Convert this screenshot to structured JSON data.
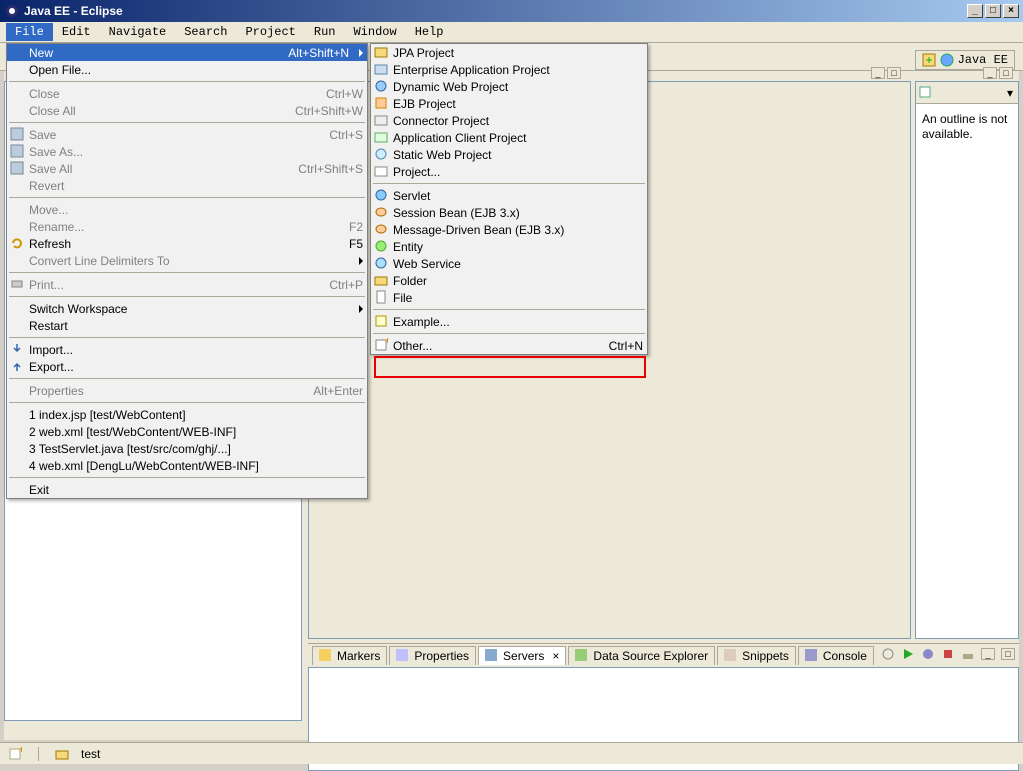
{
  "window": {
    "title": "Java EE - Eclipse"
  },
  "menubar": {
    "items": [
      "File",
      "Edit",
      "Navigate",
      "Search",
      "Project",
      "Run",
      "Window",
      "Help"
    ],
    "active_index": 0
  },
  "perspective": {
    "label": "Java EE"
  },
  "file_menu": {
    "new": {
      "label": "New",
      "accel": "Alt+Shift+N"
    },
    "open_file": {
      "label": "Open File..."
    },
    "close": {
      "label": "Close",
      "accel": "Ctrl+W"
    },
    "close_all": {
      "label": "Close All",
      "accel": "Ctrl+Shift+W"
    },
    "save": {
      "label": "Save",
      "accel": "Ctrl+S"
    },
    "save_as": {
      "label": "Save As..."
    },
    "save_all": {
      "label": "Save All",
      "accel": "Ctrl+Shift+S"
    },
    "revert": {
      "label": "Revert"
    },
    "move": {
      "label": "Move..."
    },
    "rename": {
      "label": "Rename...",
      "accel": "F2"
    },
    "refresh": {
      "label": "Refresh",
      "accel": "F5"
    },
    "convert_delim": {
      "label": "Convert Line Delimiters To"
    },
    "print": {
      "label": "Print...",
      "accel": "Ctrl+P"
    },
    "switch_ws": {
      "label": "Switch Workspace"
    },
    "restart": {
      "label": "Restart"
    },
    "import": {
      "label": "Import..."
    },
    "export": {
      "label": "Export..."
    },
    "properties": {
      "label": "Properties",
      "accel": "Alt+Enter"
    },
    "recent": [
      "1 index.jsp  [test/WebContent]",
      "2 web.xml  [test/WebContent/WEB-INF]",
      "3 TestServlet.java  [test/src/com/ghj/...]",
      "4 web.xml  [DengLu/WebContent/WEB-INF]"
    ],
    "exit": {
      "label": "Exit"
    }
  },
  "new_menu": {
    "jpa_project": "JPA Project",
    "ent_app": "Enterprise Application Project",
    "dyn_web": "Dynamic Web Project",
    "ejb_proj": "EJB Project",
    "connector": "Connector Project",
    "app_client": "Application Client Project",
    "static_web": "Static Web Project",
    "project": "Project...",
    "servlet": "Servlet",
    "session_bean": "Session Bean (EJB 3.x)",
    "mdb": "Message-Driven Bean (EJB 3.x)",
    "entity": "Entity",
    "web_service": "Web Service",
    "folder": "Folder",
    "file": "File",
    "example": "Example...",
    "other": {
      "label": "Other...",
      "accel": "Ctrl+N"
    }
  },
  "outline": {
    "text": "An outline is not available."
  },
  "bottom_tabs": {
    "markers": "Markers",
    "properties": "Properties",
    "servers": "Servers",
    "dse": "Data Source Explorer",
    "snippets": "Snippets",
    "console": "Console"
  },
  "status": {
    "project": "test"
  }
}
